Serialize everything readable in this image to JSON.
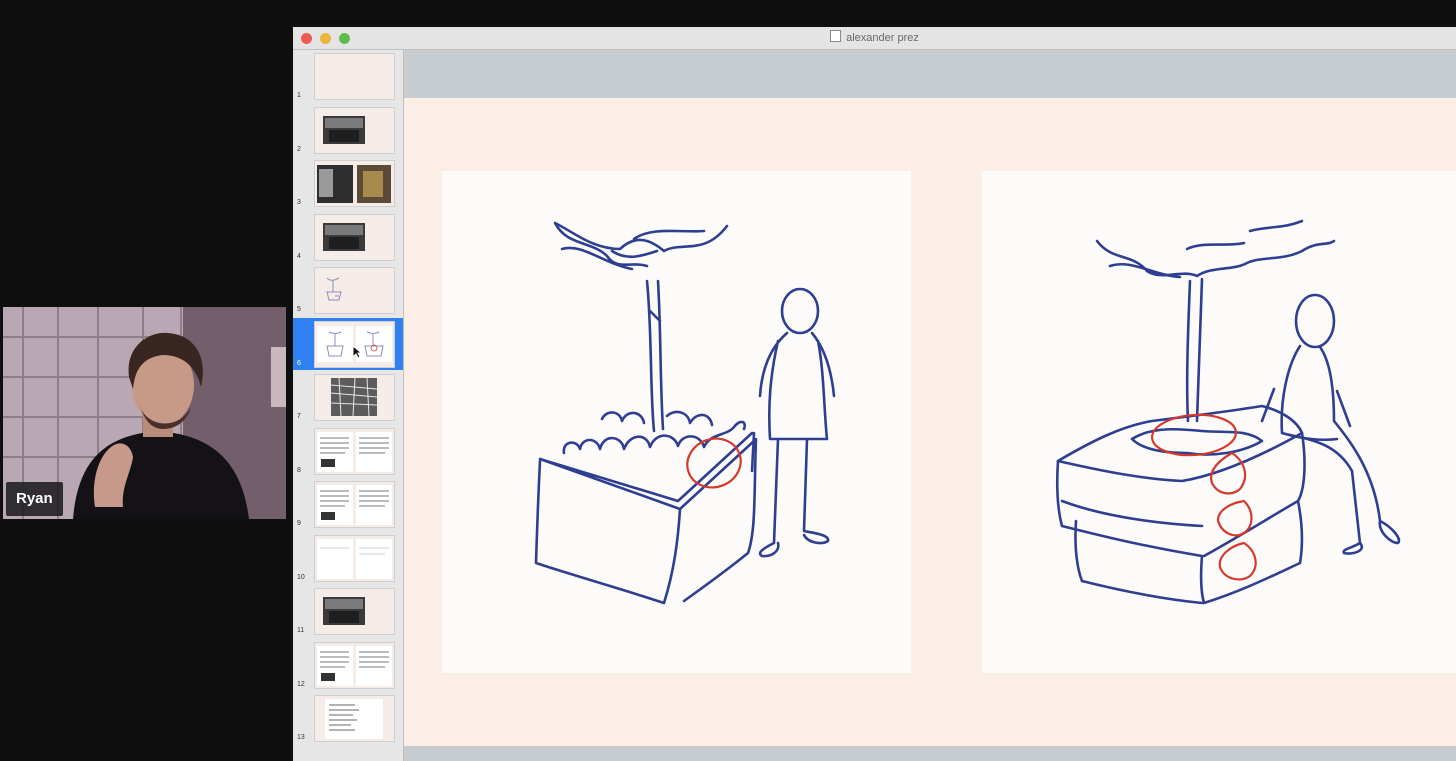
{
  "meeting": {
    "participant": {
      "name": "Ryan"
    }
  },
  "window": {
    "title": "alexander prez",
    "controls": [
      "close",
      "minimize",
      "zoom"
    ]
  },
  "slides": {
    "selected": 6,
    "thumbnails": [
      {
        "number": "1",
        "kind": "blank"
      },
      {
        "number": "2",
        "kind": "photo"
      },
      {
        "number": "3",
        "kind": "two-photos"
      },
      {
        "number": "4",
        "kind": "photo"
      },
      {
        "number": "5",
        "kind": "sketch"
      },
      {
        "number": "6",
        "kind": "two-sketches"
      },
      {
        "number": "7",
        "kind": "pattern"
      },
      {
        "number": "8",
        "kind": "text"
      },
      {
        "number": "9",
        "kind": "text"
      },
      {
        "number": "10",
        "kind": "text-light"
      },
      {
        "number": "11",
        "kind": "photo"
      },
      {
        "number": "12",
        "kind": "text"
      },
      {
        "number": "13",
        "kind": "list"
      }
    ]
  },
  "canvas": {
    "colors": {
      "ink": "#2e3f91",
      "highlight": "#d5392c",
      "slide_bg": "#fbeee7",
      "panel_bg": "#fdfbfa",
      "selection": "#2f80f0"
    },
    "left_sketch": "tree planter with standing person",
    "right_sketch": "tree planter with seated person"
  }
}
